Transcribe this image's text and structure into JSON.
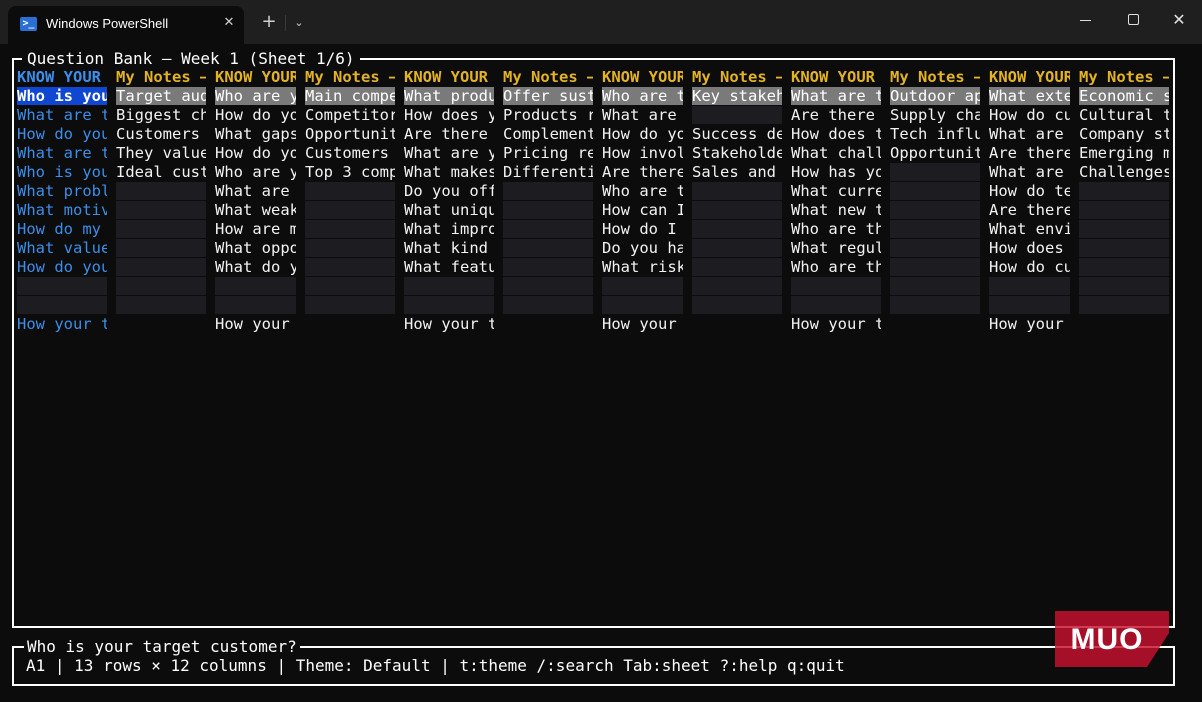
{
  "window": {
    "tab_title": "Windows PowerShell",
    "tab_icon": "powershell-icon",
    "close_tab": "✕",
    "new_tab": "+",
    "dropdown": "⌄",
    "close_window": "✕"
  },
  "sheet": {
    "title": "Question Bank — Week 1 (Sheet 1/6)",
    "columns": [
      {
        "header": "KNOW YOUR",
        "header_color": "blue",
        "cells": [
          "Who is you",
          "What are t",
          "How do you",
          "What are t",
          "Who is you",
          "What probl",
          "What motiv",
          "How do my ",
          "What value",
          "How do you",
          "",
          ""
        ],
        "footer": "How your t"
      },
      {
        "header": "My Notes —",
        "header_color": "gold",
        "cells": [
          "Target aud",
          "Biggest ch",
          "Customers ",
          "They value",
          "Ideal cust",
          "",
          "",
          "",
          "",
          "",
          "",
          ""
        ],
        "footer": ""
      },
      {
        "header": "KNOW YOUR",
        "header_color": "gold",
        "cells": [
          "Who are y",
          "How do yo",
          "What gaps",
          "How do yo",
          "Who are y",
          "What are ",
          "What weak",
          "How are m",
          "What oppo",
          "What do y",
          "",
          ""
        ],
        "footer": "How your "
      },
      {
        "header": "My Notes —",
        "header_color": "gold",
        "cells": [
          "Main compe",
          "Competitor",
          "Opportunit",
          "Customers ",
          "Top 3 comp",
          "",
          "",
          "",
          "",
          "",
          "",
          ""
        ],
        "footer": ""
      },
      {
        "header": "KNOW YOUR",
        "header_color": "gold",
        "cells": [
          "What produ",
          "How does y",
          "Are there ",
          "What are y",
          "What makes",
          "Do you off",
          "What uniqu",
          "What impro",
          "What kind ",
          "What featu",
          "",
          ""
        ],
        "footer": "How your t"
      },
      {
        "header": "My Notes —",
        "header_color": "gold",
        "cells": [
          "Offer sust",
          "Products r",
          "Complement",
          "Pricing re",
          "Differenti",
          "",
          "",
          "",
          "",
          "",
          "",
          ""
        ],
        "footer": ""
      },
      {
        "header": "KNOW YOUR",
        "header_color": "gold",
        "cells": [
          "Who are t",
          "What are ",
          "How do yo",
          "How invol",
          "Are there",
          "Who are t",
          "How can I",
          "How do I ",
          "Do you ha",
          "What risk",
          "",
          ""
        ],
        "footer": "How your "
      },
      {
        "header": "My Notes —",
        "header_color": "gold",
        "cells": [
          "Key stakeh",
          "",
          "Success de",
          "Stakeholde",
          "Sales and ",
          "",
          "",
          "",
          "",
          "",
          "",
          ""
        ],
        "footer": ""
      },
      {
        "header": "KNOW YOUR",
        "header_color": "gold",
        "cells": [
          "What are t",
          "Are there ",
          "How does t",
          "What chall",
          "How has yo",
          "What curre",
          "What new t",
          "Who are th",
          "What regul",
          "Who are th",
          "",
          ""
        ],
        "footer": "How your t"
      },
      {
        "header": "My Notes —",
        "header_color": "gold",
        "cells": [
          "Outdoor ap",
          "Supply cha",
          "Tech influ",
          "Opportunit",
          "",
          "",
          "",
          "",
          "",
          "",
          "",
          ""
        ],
        "footer": ""
      },
      {
        "header": "KNOW YOUR",
        "header_color": "gold",
        "cells": [
          "What exte",
          "How do cu",
          "What are ",
          "Are there",
          "What are ",
          "How do te",
          "Are there",
          "What envi",
          "How does ",
          "How do cu",
          "",
          ""
        ],
        "footer": "How your "
      },
      {
        "header": "My Notes —",
        "header_color": "gold",
        "cells": [
          "Economic s",
          "Cultural t",
          "Company st",
          "Emerging m",
          "Challenges",
          "",
          "",
          "",
          "",
          "",
          "",
          ""
        ],
        "footer": ""
      }
    ]
  },
  "status": {
    "current_cell_text": "Who is your target customer?",
    "info_line": "A1 | 13 rows × 12 columns | Theme: Default | t:theme /:search Tab:sheet ?:help q:quit"
  },
  "watermark": {
    "text": "MUO",
    "color": "#c8102e"
  }
}
